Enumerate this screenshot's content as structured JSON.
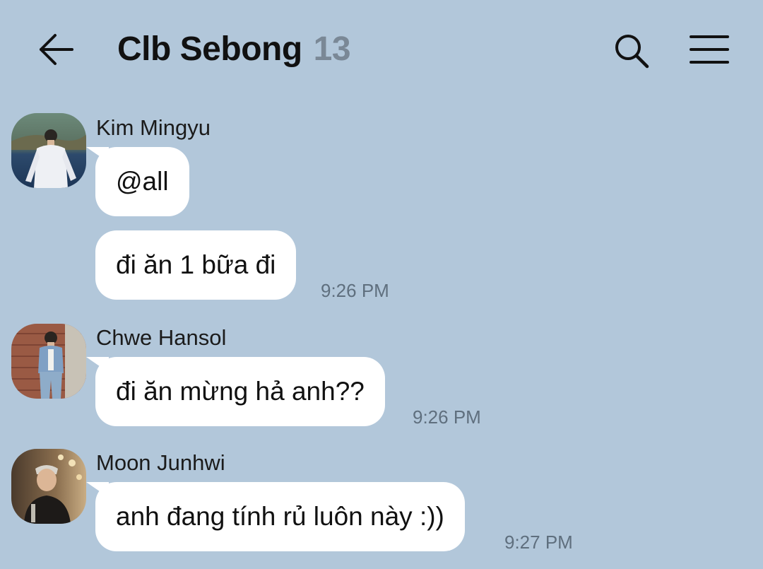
{
  "header": {
    "title": "Clb Sebong",
    "member_count": "13",
    "back_icon": "arrow-left-icon",
    "search_icon": "search-icon",
    "menu_icon": "hamburger-menu-icon"
  },
  "colors": {
    "background": "#b2c7da",
    "bubble": "#ffffff",
    "member_count": "#7a8896",
    "timestamp": "#5f6f7e"
  },
  "messages": [
    {
      "sender": "Kim Mingyu",
      "texts": [
        "@all",
        "đi ăn 1 bữa đi"
      ],
      "time": "9:26 PM"
    },
    {
      "sender": "Chwe Hansol",
      "texts": [
        "đi ăn mừng hả anh??"
      ],
      "time": "9:26 PM"
    },
    {
      "sender": "Moon Junhwi",
      "texts": [
        "anh đang tính rủ luôn này :))"
      ],
      "time": "9:27 PM"
    }
  ]
}
